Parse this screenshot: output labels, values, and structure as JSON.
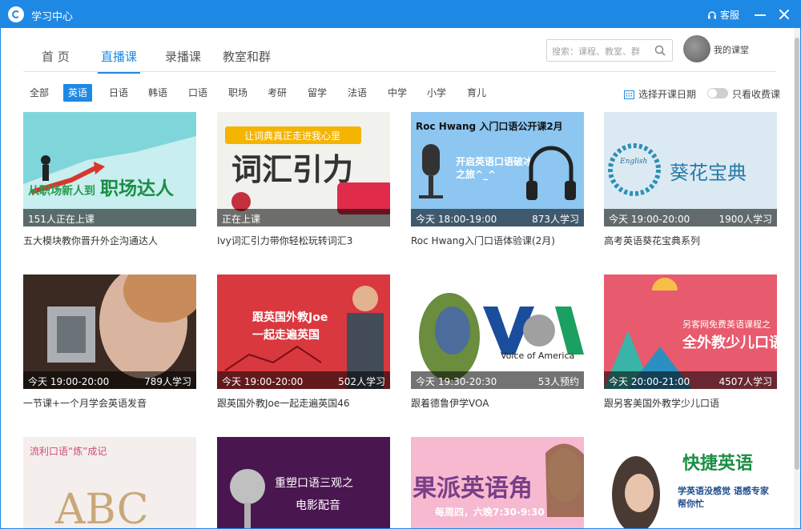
{
  "window": {
    "title": "学习中心",
    "service_label": "客服"
  },
  "tabs": [
    "首 页",
    "直播课",
    "录播课",
    "教室和群"
  ],
  "search": {
    "placeholder": "搜索：课程、教室、群"
  },
  "user": {
    "label": "我的课堂"
  },
  "filters": [
    "全部",
    "英语",
    "日语",
    "韩语",
    "口语",
    "职场",
    "考研",
    "留学",
    "法语",
    "中学",
    "小学",
    "育儿"
  ],
  "date_select_label": "选择开课日期",
  "paid_only_label": "只看收费课",
  "colors": {
    "accent": "#1e88e5"
  },
  "courses": [
    {
      "thumb_title": "职场达人",
      "thumb_sub": "从职场新人到",
      "time": "151人正在上课",
      "count": "",
      "title": "五大模块教你晋升外企沟通达人"
    },
    {
      "thumb_title": "词汇引力",
      "thumb_sub": "让词典真正走进我心里",
      "time": "正在上课",
      "count": "",
      "title": "Ivy词汇引力带你轻松玩转词汇3"
    },
    {
      "thumb_title": "Roc Hwang 入门口语公开课2月",
      "thumb_sub": "开启英语口语破冰之旅^_^",
      "time": "今天 18:00-19:00",
      "count": "873人学习",
      "title": "Roc Hwang入门口语体验课(2月)"
    },
    {
      "thumb_title": "葵花宝典",
      "thumb_sub": "English",
      "time": "今天 19:00-20:00",
      "count": "1900人学习",
      "title": "高考英语葵花宝典系列"
    },
    {
      "thumb_title": "",
      "thumb_sub": "",
      "time": "今天 19:00-20:00",
      "count": "789人学习",
      "title": "一节课+一个月学会英语发音"
    },
    {
      "thumb_title": "跟英国外教Joe",
      "thumb_sub": "一起走遍英国",
      "time": "今天 19:00-20:00",
      "count": "502人学习",
      "title": "跟英国外教Joe一起走遍英国46"
    },
    {
      "thumb_title": "Voice of America",
      "thumb_sub": "VOA",
      "time": "今天 19:30-20:30",
      "count": "53人预约",
      "title": "跟着德鲁伊学VOA"
    },
    {
      "thumb_title": "全外教少儿口语",
      "thumb_sub": "另客网免费英语课程之",
      "time": "今天 20:00-21:00",
      "count": "4507人学习",
      "title": "跟另客美国外教学少儿口语"
    },
    {
      "thumb_title": "ABC",
      "thumb_sub": "流利口语“炼”成记",
      "time": "",
      "count": "",
      "title": ""
    },
    {
      "thumb_title": "重塑口语三观之",
      "thumb_sub": "电影配音",
      "time": "",
      "count": "",
      "title": ""
    },
    {
      "thumb_title": "果派英语角",
      "thumb_sub": "每周四，六晚7:30-9:30",
      "time": "",
      "count": "",
      "title": ""
    },
    {
      "thumb_title": "快捷英语",
      "thumb_sub": "学英语没感觉 语感专家帮你忙",
      "time": "",
      "count": "",
      "title": ""
    }
  ]
}
